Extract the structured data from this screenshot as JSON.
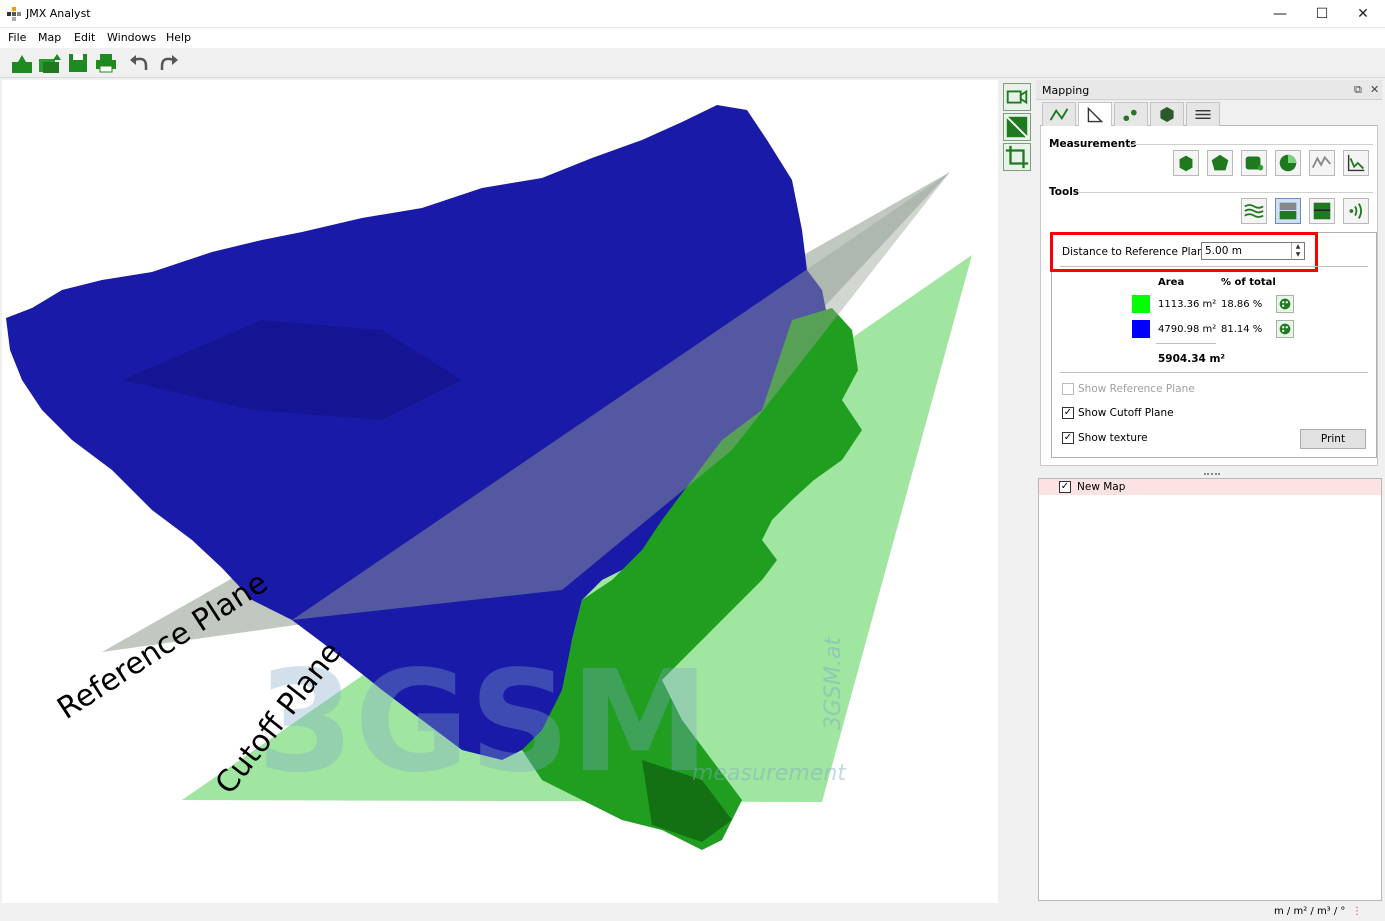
{
  "window": {
    "title": "JMX Analyst",
    "minimize": "—",
    "maximize": "☐",
    "close": "✕"
  },
  "menu": [
    "File",
    "Map",
    "Edit",
    "Windows",
    "Help"
  ],
  "toolbar": [
    "open-icon",
    "open-multiple-icon",
    "save-icon",
    "print-icon",
    "undo-icon",
    "redo-icon"
  ],
  "viewport": {
    "watermark": "3GSM",
    "watermark_side": "3GSM.at",
    "watermark_sub": "measurement",
    "reference_label": "Reference Plane",
    "cutoff_label": "Cutoff Plane",
    "colors": {
      "above": "#1a1aa8",
      "below": "#1f9e1f",
      "reference": "#8c9a8c",
      "cutoff": "#8fe08f"
    }
  },
  "mapping": {
    "title": "Mapping",
    "tabs": [
      "trajectory-tab",
      "measure-tab",
      "points-tab",
      "shape-tab",
      "settings-tab"
    ],
    "measurements_label": "Measurements",
    "tools_label": "Tools",
    "distance_label": "Distance to Reference Plane:",
    "distance_value": "5.00 m",
    "table": {
      "head_area": "Area",
      "head_percent": "% of total",
      "rows": [
        {
          "color": "#00ff00",
          "area": "1113.36 m²",
          "percent": "18.86 %"
        },
        {
          "color": "#0000ff",
          "area": "4790.98 m²",
          "percent": "81.14 %"
        }
      ],
      "total": "5904.34 m²"
    },
    "show_reference_plane": {
      "label": "Show Reference Plane",
      "checked": ""
    },
    "show_cutoff_plane": {
      "label": "Show Cutoff Plane",
      "checked": "✓"
    },
    "show_texture": {
      "label": "Show texture",
      "checked": "✓"
    },
    "print_label": "Print"
  },
  "layers": {
    "name": "New Map",
    "checked": "✓"
  },
  "status": {
    "units": "m / m² / m³ / °"
  }
}
